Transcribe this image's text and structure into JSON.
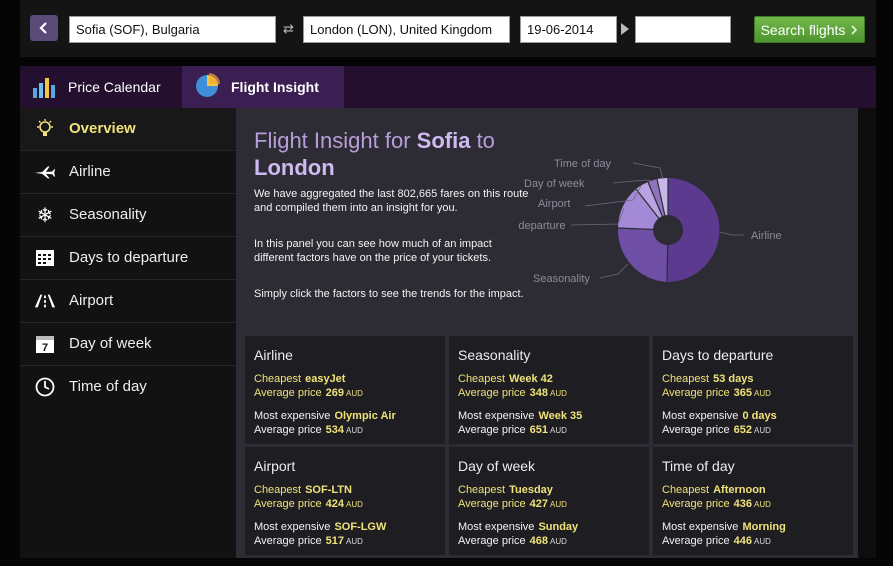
{
  "search": {
    "from": "Sofia (SOF), Bulgaria",
    "to": "London (LON), United Kingdom",
    "date": "19-06-2014",
    "return_date": "",
    "button": "Search flights"
  },
  "tabs": [
    {
      "label": "Price Calendar"
    },
    {
      "label": "Flight Insight"
    }
  ],
  "sidebar": {
    "items": [
      {
        "label": "Overview"
      },
      {
        "label": "Airline"
      },
      {
        "label": "Seasonality"
      },
      {
        "label": "Days to departure"
      },
      {
        "label": "Airport"
      },
      {
        "label": "Day of week"
      },
      {
        "label": "Time of day"
      }
    ]
  },
  "insight": {
    "title_prefix": "Flight Insight for",
    "origin": "Sofia",
    "title_mid": "to",
    "destination": "London",
    "desc1": "We have aggregated the last 802,665 fares on this route and compiled them into an insight for you.",
    "desc2": "In this panel you can see how much of an impact different factors have on the price of your tickets.",
    "desc3": "Simply click the factors to see the trends for the impact."
  },
  "pie": {
    "labels": {
      "time_of_day": "Time of day",
      "day_of_week": "Day of week",
      "airport": "Airport",
      "days_to_departure": "Days to departure",
      "seasonality": "Seasonality",
      "airline": "Airline"
    }
  },
  "cards": [
    {
      "title": "Airline",
      "cheapest_label": "Cheapest",
      "cheapest": "easyJet",
      "avg_label": "Average price",
      "cheap_price": "269",
      "unit": "AUD",
      "exp_label": "Most expensive",
      "expensive": "Olympic Air",
      "exp_price": "534"
    },
    {
      "title": "Seasonality",
      "cheapest_label": "Cheapest",
      "cheapest": "Week 42",
      "avg_label": "Average price",
      "cheap_price": "348",
      "unit": "AUD",
      "exp_label": "Most expensive",
      "expensive": "Week 35",
      "exp_price": "651"
    },
    {
      "title": "Days to departure",
      "cheapest_label": "Cheapest",
      "cheapest": "53 days",
      "avg_label": "Average price",
      "cheap_price": "365",
      "unit": "AUD",
      "exp_label": "Most expensive",
      "expensive": "0 days",
      "exp_price": "652"
    },
    {
      "title": "Airport",
      "cheapest_label": "Cheapest",
      "cheapest": "SOF-LTN",
      "avg_label": "Average price",
      "cheap_price": "424",
      "unit": "AUD",
      "exp_label": "Most expensive",
      "expensive": "SOF-LGW",
      "exp_price": "517"
    },
    {
      "title": "Day of week",
      "cheapest_label": "Cheapest",
      "cheapest": "Tuesday",
      "avg_label": "Average price",
      "cheap_price": "427",
      "unit": "AUD",
      "exp_label": "Most expensive",
      "expensive": "Sunday",
      "exp_price": "468"
    },
    {
      "title": "Time of day",
      "cheapest_label": "Cheapest",
      "cheapest": "Afternoon",
      "avg_label": "Average price",
      "cheap_price": "436",
      "unit": "AUD",
      "exp_label": "Most expensive",
      "expensive": "Morning",
      "exp_price": "446"
    }
  ],
  "colors": {
    "accent": "#f0e27a",
    "title": "#b79ed9",
    "button": "#5ea63b"
  }
}
